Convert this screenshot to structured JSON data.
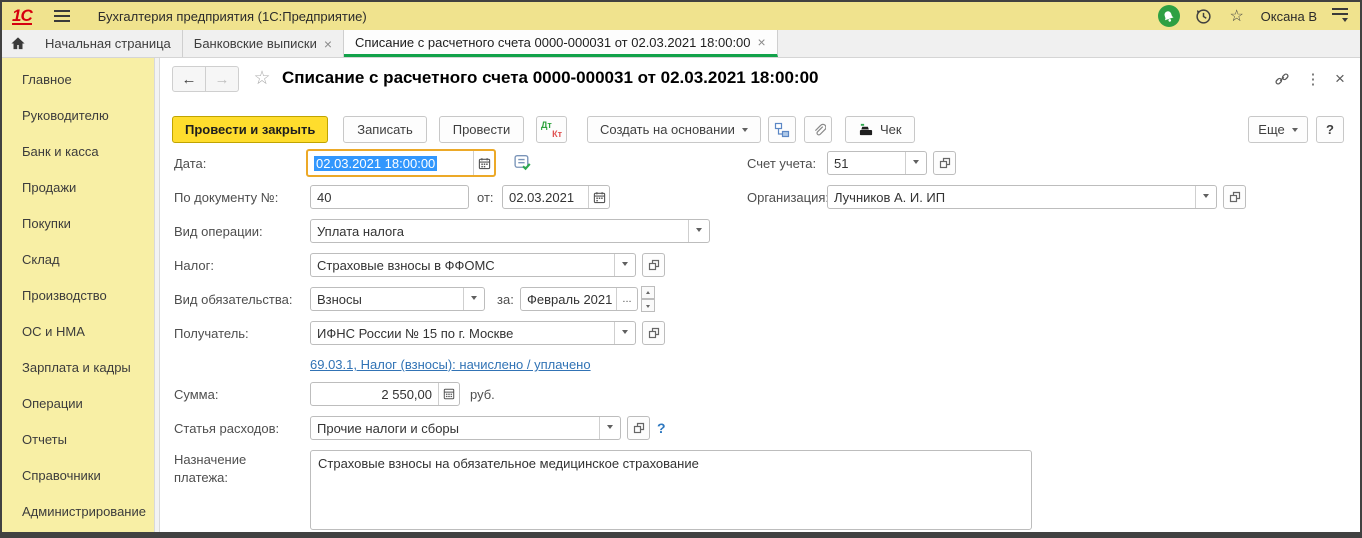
{
  "app": {
    "logo_text": "1С",
    "title": "Бухгалтерия предприятия  (1С:Предприятие)",
    "user": "Оксана В"
  },
  "icons": {
    "star": "☆",
    "close": "×",
    "back": "←",
    "forward": "→",
    "more_dots": "⋮"
  },
  "colors": {
    "topbar": "#F0E38E",
    "sidebar": "#F8EFA5",
    "primary_button": "#FFDD2D",
    "active_tab_underline": "#12A24A",
    "selection": "#3297FD",
    "focus_ring": "#ECA928",
    "link": "#3173B5",
    "logo_red": "#D6000F",
    "notification_green": "#2EA043"
  },
  "tabs": [
    {
      "label": "Начальная страница"
    },
    {
      "label": "Банковские выписки"
    },
    {
      "label": "Списание с расчетного счета 0000-000031 от 02.03.2021 18:00:00"
    }
  ],
  "sidebar": {
    "items": [
      "Главное",
      "Руководителю",
      "Банк и касса",
      "Продажи",
      "Покупки",
      "Склад",
      "Производство",
      "ОС и НМА",
      "Зарплата и кадры",
      "Операции",
      "Отчеты",
      "Справочники",
      "Администрирование"
    ]
  },
  "doc": {
    "title": "Списание с расчетного счета 0000-000031 от 02.03.2021 18:00:00",
    "toolbar": {
      "post_and_close": "Провести и закрыть",
      "save": "Записать",
      "post": "Провести",
      "dt": "Дт",
      "kt": "Кт",
      "create_based_on": "Создать на основании",
      "check": "Чек",
      "more": "Еще",
      "help": "?"
    },
    "fields": {
      "date": {
        "label": "Дата:",
        "value": "02.03.2021 18:00:00"
      },
      "account": {
        "label": "Счет учета:",
        "value": "51"
      },
      "doc_number": {
        "label": "По документу №:",
        "value": "40",
        "from_label": "от:",
        "from_value": "02.03.2021"
      },
      "organization": {
        "label": "Организация:",
        "value": "Лучников А. И. ИП"
      },
      "operation_type": {
        "label": "Вид операции:",
        "value": "Уплата налога"
      },
      "tax": {
        "label": "Налог:",
        "value": "Страховые взносы в ФФОМС"
      },
      "obligation": {
        "label": "Вид обязательства:",
        "value": "Взносы",
        "period_label": "за:",
        "period_value": "Февраль 2021",
        "ellipsis": "..."
      },
      "recipient": {
        "label": "Получатель:",
        "value": "ИФНС России № 15 по г. Москве"
      },
      "account_link": {
        "text": "69.03.1, Налог (взносы): начислено / уплачено"
      },
      "amount": {
        "label": "Сумма:",
        "value": "2 550,00",
        "currency": "руб."
      },
      "expense_item": {
        "label": "Статья расходов:",
        "value": "Прочие налоги и сборы",
        "help": "?"
      },
      "payment_purpose": {
        "label": "Назначение платежа:",
        "value": "Страховые взносы на обязательное медицинское страхование"
      }
    }
  }
}
